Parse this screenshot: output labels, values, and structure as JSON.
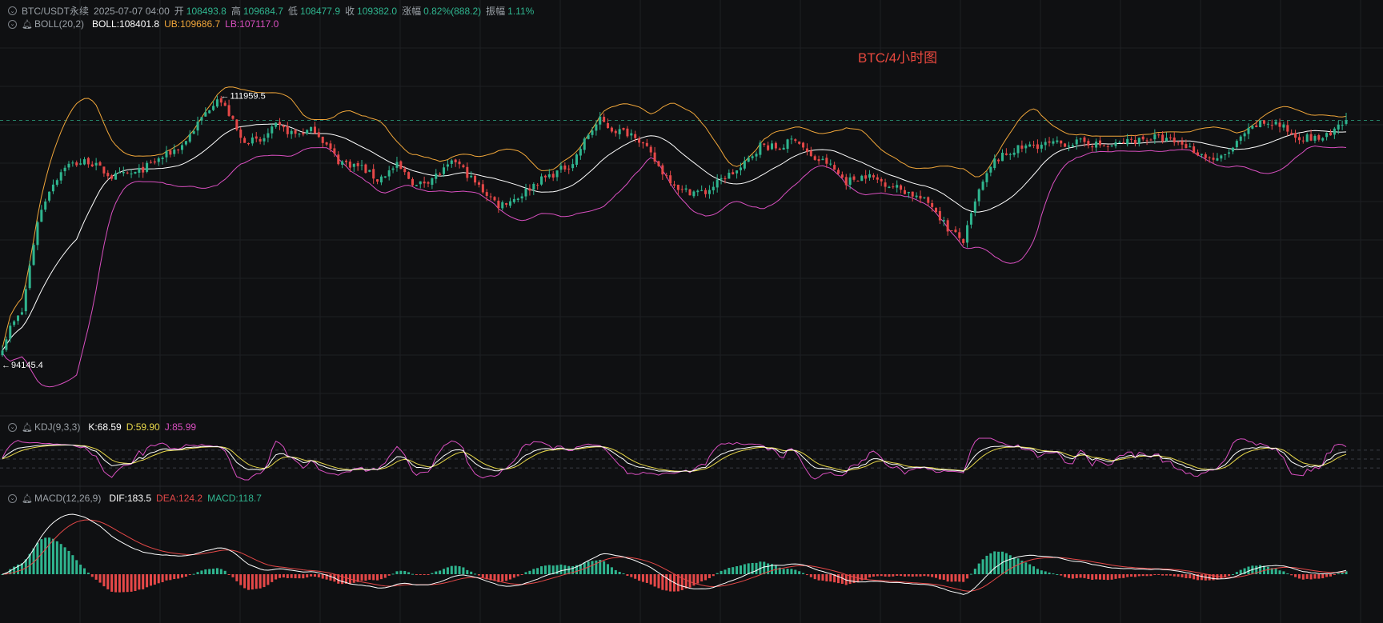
{
  "header": {
    "symbol": "BTC/USDT永续",
    "datetime": "2025-07-07 04:00",
    "open_label": "开",
    "open": "108493.8",
    "high_label": "高",
    "high": "109684.7",
    "low_label": "低",
    "low": "108477.9",
    "close_label": "收",
    "close": "109382.0",
    "change_label": "涨幅",
    "change": "0.82%(888.2)",
    "amplitude_label": "振幅",
    "amplitude": "1.11%"
  },
  "boll": {
    "label": "BOLL(20,2)",
    "mid": "BOLL:108401.8",
    "ub": "UB:109686.7",
    "lb": "LB:107117.0"
  },
  "kdj": {
    "label": "KDJ(9,3,3)",
    "k": "K:68.59",
    "d": "D:59.90",
    "j": "J:85.99"
  },
  "macd": {
    "label": "MACD(12,26,9)",
    "dif": "DIF:183.5",
    "dea": "DEA:124.2",
    "macd": "MACD:118.7"
  },
  "chart_title": "BTC/4小时图",
  "colors": {
    "up": "#2fb58f",
    "down": "#e54848",
    "mid": "#ffffff",
    "ub": "#f0a63a",
    "lb": "#d94fc0",
    "k": "#ffffff",
    "d": "#e8d84a",
    "j": "#d94fc0",
    "dif": "#ffffff",
    "dea": "#e54848",
    "background": "#0f1012",
    "title": "#e8483e"
  },
  "chart_data": {
    "type": "candlestick",
    "title": "BTC/4小时图",
    "ylim": [
      91000,
      115000
    ],
    "annotations": [
      {
        "text": "111959.5",
        "value": 111959.5,
        "kind": "max"
      },
      {
        "text": "94145.4",
        "value": 94145.4,
        "kind": "min"
      }
    ],
    "current_price": 109382.0,
    "price_anchors": [
      [
        0,
        95000
      ],
      [
        2,
        96200
      ],
      [
        5,
        97200
      ],
      [
        9,
        103000
      ],
      [
        12,
        105000
      ],
      [
        16,
        106500
      ],
      [
        22,
        106800
      ],
      [
        28,
        105800
      ],
      [
        34,
        106000
      ],
      [
        40,
        106900
      ],
      [
        46,
        107800
      ],
      [
        51,
        109500
      ],
      [
        55,
        110900
      ],
      [
        58,
        109800
      ],
      [
        61,
        108200
      ],
      [
        66,
        108000
      ],
      [
        70,
        109000
      ],
      [
        75,
        108500
      ],
      [
        80,
        108800
      ],
      [
        86,
        106800
      ],
      [
        92,
        106400
      ],
      [
        96,
        105600
      ],
      [
        101,
        106500
      ],
      [
        106,
        105200
      ],
      [
        112,
        106000
      ],
      [
        116,
        106800
      ],
      [
        121,
        105400
      ],
      [
        127,
        104000
      ],
      [
        132,
        104500
      ],
      [
        137,
        105500
      ],
      [
        142,
        106100
      ],
      [
        146,
        106700
      ],
      [
        150,
        108500
      ],
      [
        153,
        109400
      ],
      [
        156,
        108800
      ],
      [
        162,
        108500
      ],
      [
        165,
        107500
      ],
      [
        169,
        106100
      ],
      [
        174,
        104900
      ],
      [
        180,
        104800
      ],
      [
        185,
        105800
      ],
      [
        189,
        106300
      ],
      [
        194,
        107800
      ],
      [
        199,
        107600
      ],
      [
        203,
        108300
      ],
      [
        207,
        107000
      ],
      [
        211,
        106700
      ],
      [
        216,
        105500
      ],
      [
        221,
        105900
      ],
      [
        226,
        105400
      ],
      [
        232,
        104800
      ],
      [
        238,
        104000
      ],
      [
        242,
        102500
      ],
      [
        246,
        101700
      ],
      [
        250,
        104900
      ],
      [
        254,
        106800
      ],
      [
        259,
        107500
      ],
      [
        264,
        107800
      ],
      [
        271,
        107900
      ],
      [
        277,
        108000
      ],
      [
        283,
        107700
      ],
      [
        289,
        108100
      ],
      [
        295,
        108300
      ],
      [
        302,
        107900
      ],
      [
        307,
        107200
      ],
      [
        311,
        106800
      ],
      [
        315,
        107600
      ],
      [
        318,
        108500
      ],
      [
        322,
        109200
      ],
      [
        326,
        109200
      ],
      [
        331,
        108400
      ],
      [
        336,
        108200
      ],
      [
        340,
        108400
      ],
      [
        344,
        109382
      ]
    ],
    "indicators": {
      "BOLL(20,2)": {
        "mid": 108401.8,
        "ub": 109686.7,
        "lb": 107117.0
      },
      "KDJ(9,3,3)": {
        "K": 68.59,
        "D": 59.9,
        "J": 85.99
      },
      "MACD(12,26,9)": {
        "DIF": 183.5,
        "DEA": 124.2,
        "MACD": 118.7
      }
    }
  }
}
